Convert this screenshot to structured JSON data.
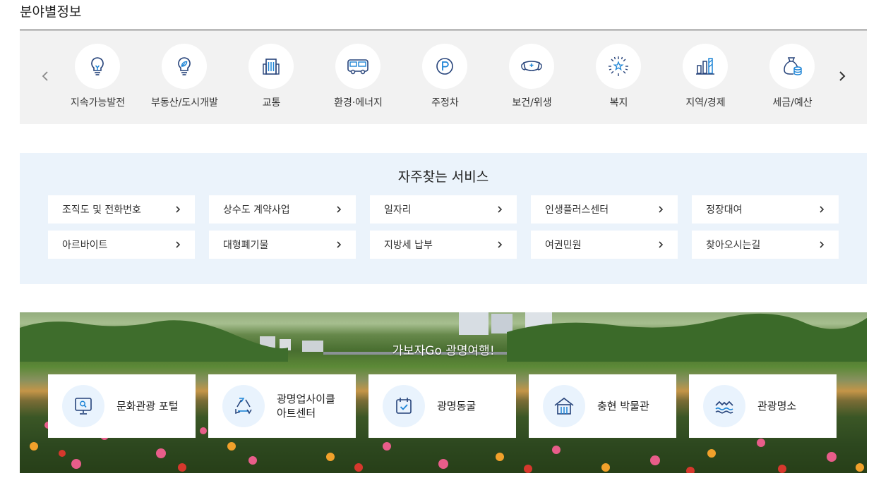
{
  "section_title": "분야별정보",
  "fields": [
    {
      "label": "지속가능발전",
      "icon": "lightbulb-icon"
    },
    {
      "label": "부동산/도시개발",
      "icon": "leaf-bulb-icon"
    },
    {
      "label": "교통",
      "icon": "building-icon"
    },
    {
      "label": "환경·에너지",
      "icon": "bus-icon"
    },
    {
      "label": "주정차",
      "icon": "parking-icon"
    },
    {
      "label": "보건/위생",
      "icon": "mask-icon"
    },
    {
      "label": "복지",
      "icon": "star-burst-icon"
    },
    {
      "label": "지역/경제",
      "icon": "bar-chart-icon"
    },
    {
      "label": "세금/예산",
      "icon": "money-bag-icon"
    }
  ],
  "services": {
    "title": "자주찾는 서비스",
    "items": [
      {
        "label": "조직도 및 전화번호"
      },
      {
        "label": "상수도 계약사업"
      },
      {
        "label": "일자리"
      },
      {
        "label": "인생플러스센터"
      },
      {
        "label": "정장대여"
      },
      {
        "label": "아르바이트"
      },
      {
        "label": "대형폐기물"
      },
      {
        "label": "지방세 납부"
      },
      {
        "label": "여권민원"
      },
      {
        "label": "찾아오시는길"
      }
    ]
  },
  "travel": {
    "title": "가보자Go 광명여행!",
    "cards": [
      {
        "label": "문화관광 포털",
        "icon": "monitor-search-icon"
      },
      {
        "label": "광명업사이클\n아트센터",
        "icon": "recycle-icon"
      },
      {
        "label": "광명동굴",
        "icon": "calendar-check-icon"
      },
      {
        "label": "충현 박물관",
        "icon": "house-icon"
      },
      {
        "label": "관광명소",
        "icon": "waves-icon"
      }
    ]
  },
  "colors": {
    "accent": "#1c84d6",
    "icon_navy": "#26437a",
    "strip_bg": "#f2f2f2",
    "services_bg": "#ebf3fb",
    "icon_circle_bg": "#e9f3fd"
  }
}
